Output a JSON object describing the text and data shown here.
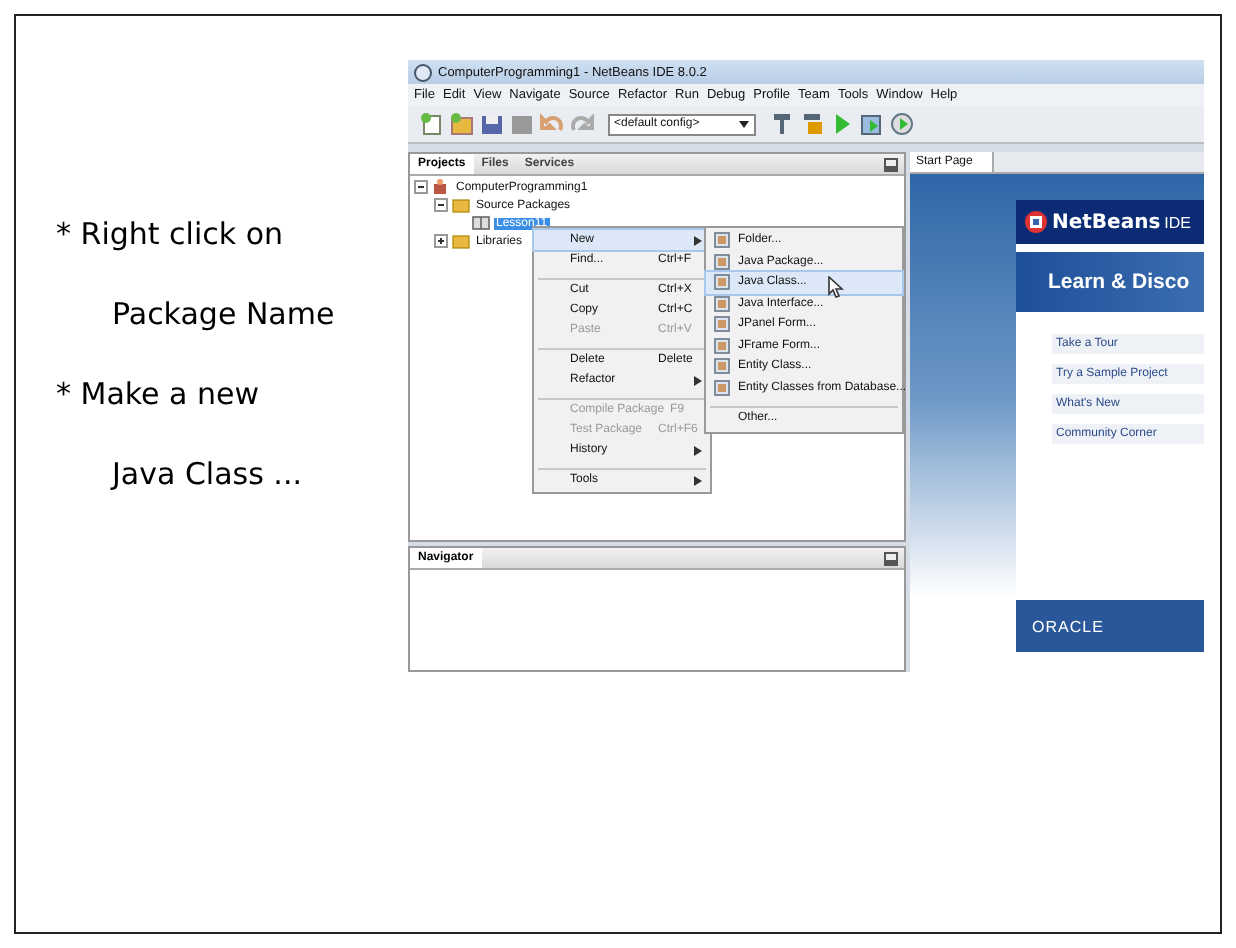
{
  "instructions": [
    {
      "kind": "bullet",
      "text": "* Right click on"
    },
    {
      "kind": "continuation",
      "text": "Package Name"
    },
    {
      "kind": "bullet",
      "text": "* Make a new"
    },
    {
      "kind": "continuation",
      "text": "Java Class ..."
    }
  ],
  "ide": {
    "window_title": "ComputerProgramming1 - NetBeans IDE 8.0.2",
    "menu": [
      "File",
      "Edit",
      "View",
      "Navigate",
      "Source",
      "Refactor",
      "Run",
      "Debug",
      "Profile",
      "Team",
      "Tools",
      "Window",
      "Help"
    ],
    "config": "<default config>",
    "panel_tabs": [
      {
        "label": "Projects",
        "selected": true
      },
      {
        "label": "Files",
        "selected": false
      },
      {
        "label": "Services",
        "selected": false
      }
    ],
    "tree": [
      {
        "label": "ComputerProgramming1",
        "kind": "project",
        "expanded": true,
        "selected": false,
        "children": [
          {
            "label": "Source Packages",
            "kind": "folder",
            "expanded": true,
            "selected": false,
            "children": [
              {
                "label": "Lesson11",
                "kind": "package",
                "selected": true
              }
            ]
          },
          {
            "label": "Libraries",
            "kind": "folder",
            "expanded": false,
            "selected": false
          }
        ]
      }
    ],
    "context_menu": [
      {
        "label": "New",
        "submenu": true,
        "disabled": false,
        "separator_before": false,
        "selected": true
      },
      {
        "label": "Find...",
        "shortcut": "Ctrl+F",
        "submenu": false,
        "disabled": false,
        "separator_before": false,
        "selected": false
      },
      {
        "label": "Cut",
        "shortcut": "Ctrl+X",
        "submenu": false,
        "disabled": false,
        "separator_before": true,
        "selected": false
      },
      {
        "label": "Copy",
        "shortcut": "Ctrl+C",
        "submenu": false,
        "disabled": false,
        "separator_before": false,
        "selected": false
      },
      {
        "label": "Paste",
        "shortcut": "Ctrl+V",
        "submenu": false,
        "disabled": true,
        "separator_before": false,
        "selected": false
      },
      {
        "label": "Delete",
        "shortcut": "Delete",
        "submenu": false,
        "disabled": false,
        "separator_before": true,
        "selected": false
      },
      {
        "label": "Refactor",
        "submenu": true,
        "disabled": false,
        "separator_before": false,
        "selected": false
      },
      {
        "label": "Compile Package",
        "shortcut": "F9",
        "submenu": false,
        "disabled": true,
        "separator_before": true,
        "selected": false
      },
      {
        "label": "Test Package",
        "shortcut": "Ctrl+F6",
        "submenu": false,
        "disabled": true,
        "separator_before": false,
        "selected": false
      },
      {
        "label": "History",
        "submenu": true,
        "disabled": false,
        "separator_before": false,
        "selected": false
      },
      {
        "label": "Tools",
        "submenu": true,
        "disabled": false,
        "separator_before": true,
        "selected": false
      }
    ],
    "new_submenu": [
      {
        "label": "Folder...",
        "icon": true,
        "separator_before": false,
        "selected": false
      },
      {
        "label": "Java Package...",
        "icon": true,
        "separator_before": false,
        "selected": false
      },
      {
        "label": "Java Class...",
        "icon": true,
        "separator_before": false,
        "selected": true
      },
      {
        "label": "Java Interface...",
        "icon": true,
        "separator_before": false,
        "selected": false
      },
      {
        "label": "JPanel Form...",
        "icon": true,
        "separator_before": false,
        "selected": false
      },
      {
        "label": "JFrame Form...",
        "icon": true,
        "separator_before": false,
        "selected": false
      },
      {
        "label": "Entity Class...",
        "icon": true,
        "separator_before": false,
        "selected": false
      },
      {
        "label": "Entity Classes from Database...",
        "icon": true,
        "separator_before": false,
        "selected": false
      },
      {
        "label": "Other...",
        "icon": false,
        "separator_before": true,
        "selected": false
      }
    ],
    "navigator_title": "Navigator",
    "editor_tabs": [
      {
        "label": "Start Page",
        "selected": true
      }
    ],
    "start_page": {
      "brand": "NetBeans",
      "brand_suffix": "IDE",
      "heading": "Learn & Disco",
      "links": [
        "Take a Tour",
        "Try a Sample Project",
        "What's New",
        "Community Corner"
      ],
      "footer": "ORACLE"
    }
  }
}
